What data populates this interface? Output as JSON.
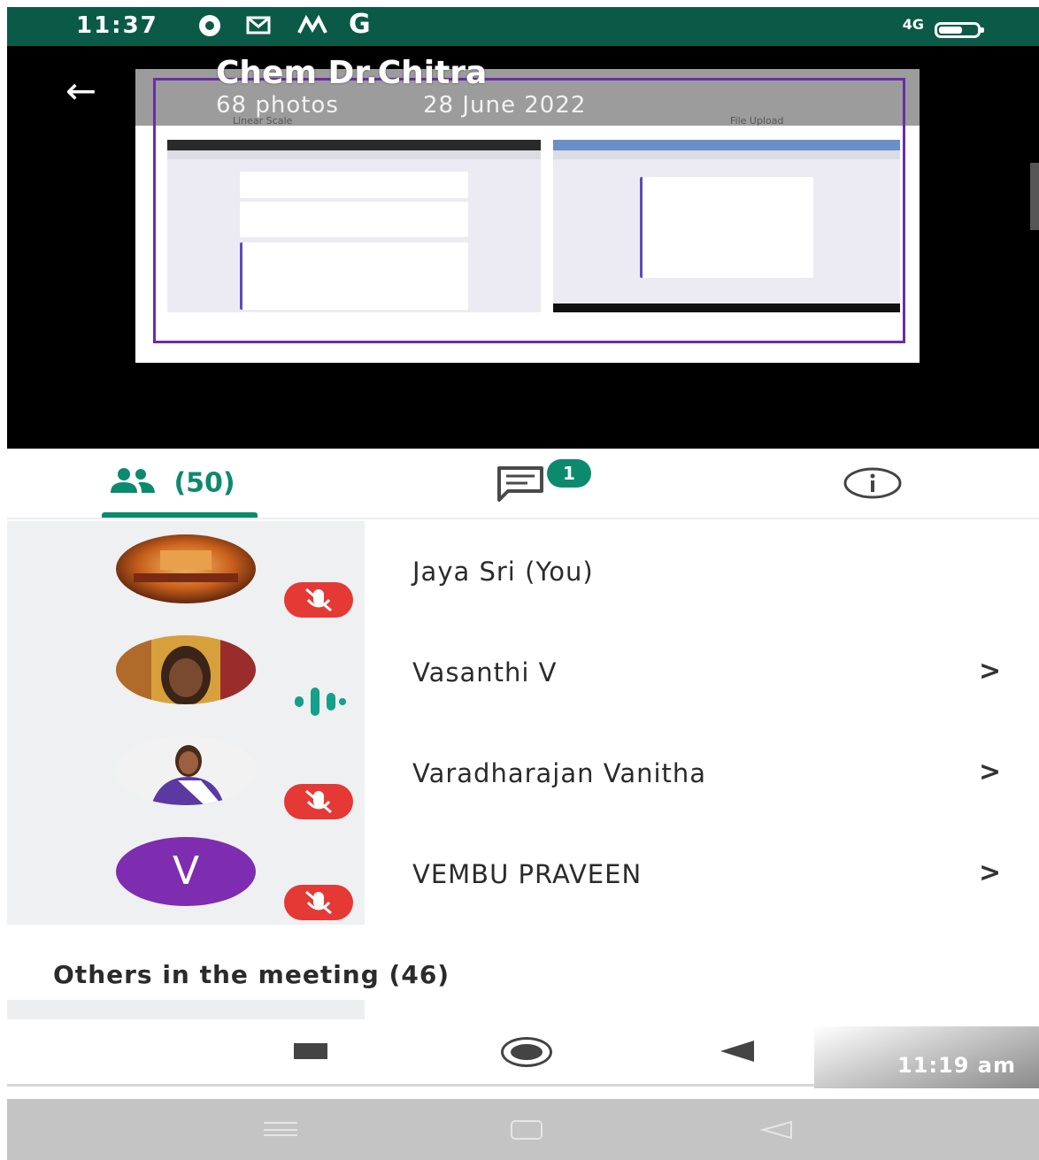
{
  "status_bar": {
    "time": "11:37",
    "icons": [
      "chrome-icon",
      "gmail-icon",
      "maps-icon",
      "google-icon"
    ],
    "network": "4G",
    "battery_icon": "battery-icon"
  },
  "viewer": {
    "title": "Chem Dr.Chitra",
    "photos": "68 photos",
    "date": "28 June 2022",
    "slide_labels": [
      "Linear Scale",
      "File Upload"
    ]
  },
  "tabs": {
    "people_count": "(50)",
    "chat_badge": "1"
  },
  "participants": [
    {
      "name": "Jaya Sri (You)",
      "avatar": "photo-temple",
      "audio": "muted"
    },
    {
      "name": "Vasanthi V",
      "avatar": "photo-woman",
      "audio": "speaking"
    },
    {
      "name": "Varadharajan Vanitha",
      "avatar": "photo-woman-2",
      "audio": "muted"
    },
    {
      "name": "VEMBU PRAVEEN",
      "avatar_letter": "V",
      "avatar_color": "#7e2db0",
      "audio": "muted"
    }
  ],
  "others_label": "Others in the meeting (46)",
  "timestamp": "11:19 am",
  "colors": {
    "accent": "#0b8a6e",
    "status_bar": "#0b5a47",
    "mute": "#e53935"
  }
}
